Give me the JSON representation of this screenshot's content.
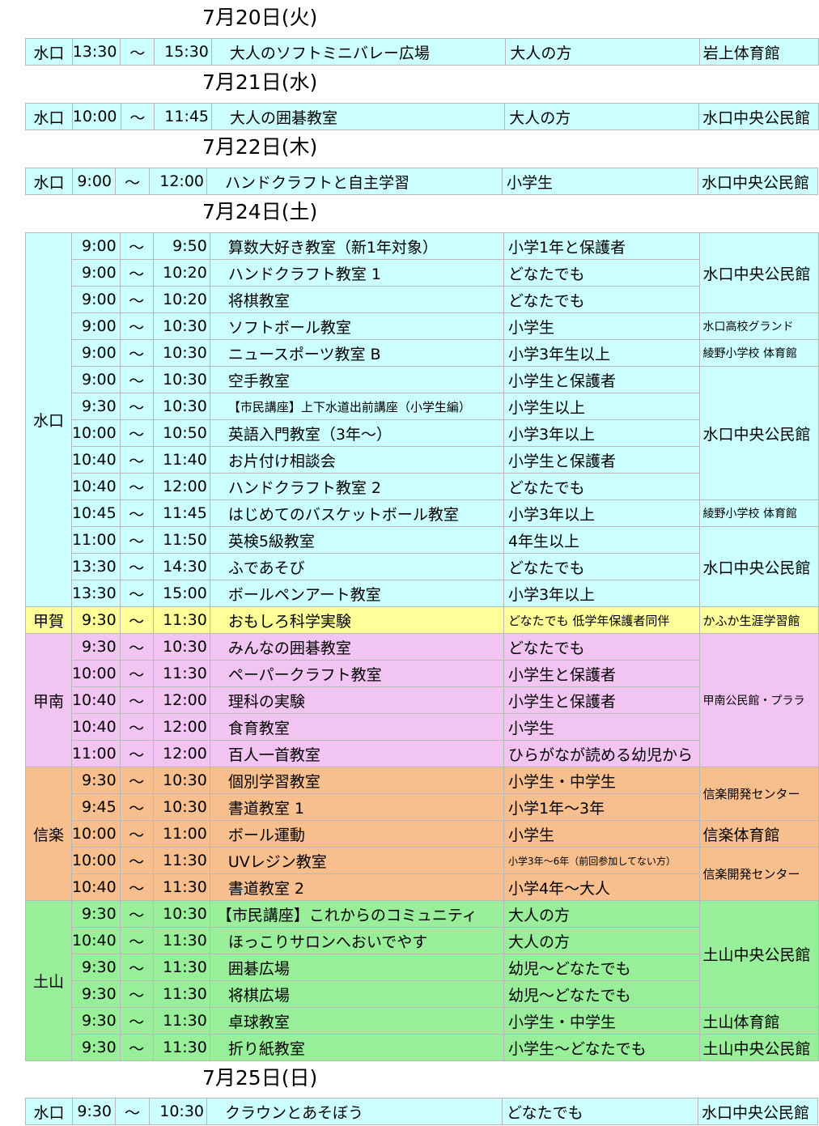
{
  "days": [
    {
      "date": "7月20日(火)",
      "rows": [
        {
          "area": "水口",
          "start": "13:30",
          "tilde": "～",
          "end": "15:30",
          "name": "大人のソフトミニバレー広場",
          "target": "大人の方",
          "venue": "岩上体育館"
        }
      ]
    },
    {
      "date": "7月21日(水)",
      "rows": [
        {
          "area": "水口",
          "start": "10:00",
          "tilde": "～",
          "end": "11:45",
          "name": "大人の囲碁教室",
          "target": "大人の方",
          "venue": "水口中央公民館"
        }
      ]
    },
    {
      "date": "7月22日(木)",
      "rows": [
        {
          "area": "水口",
          "start": "9:00",
          "tilde": "～",
          "end": "12:00",
          "name": "ハンドクラフトと自主学習",
          "target": "小学生",
          "venue": "水口中央公民館"
        }
      ]
    },
    {
      "date": "7月24日(土)",
      "rows": [
        {
          "area": "水口",
          "start": "9:00",
          "tilde": "～",
          "end": "9:50",
          "name": "算数大好き教室（新1年対象）",
          "target": "小学1年と保護者",
          "venue": "水口中央公民館"
        },
        {
          "start": "9:00",
          "tilde": "～",
          "end": "10:20",
          "name": "ハンドクラフト教室 1",
          "target": "どなたでも"
        },
        {
          "start": "9:00",
          "tilde": "～",
          "end": "10:20",
          "name": "将棋教室",
          "target": "どなたでも"
        },
        {
          "start": "9:00",
          "tilde": "～",
          "end": "10:30",
          "name": "ソフトボール教室",
          "target": "小学生",
          "venue": "水口高校グランド"
        },
        {
          "start": "9:00",
          "tilde": "～",
          "end": "10:30",
          "name": "ニュースポーツ教室 B",
          "target": "小学3年生以上",
          "venue": "綾野小学校 体育館"
        },
        {
          "start": "9:00",
          "tilde": "～",
          "end": "10:30",
          "name": "空手教室",
          "target": "小学生と保護者",
          "venue": "水口中央公民館"
        },
        {
          "start": "9:30",
          "tilde": "～",
          "end": "10:30",
          "name": "【市民講座】上下水道出前講座（小学生編）",
          "target": "小学生以上"
        },
        {
          "start": "10:00",
          "tilde": "～",
          "end": "10:50",
          "name": "英語入門教室（3年～）",
          "target": "小学3年以上"
        },
        {
          "start": "10:40",
          "tilde": "～",
          "end": "11:40",
          "name": "お片付け相談会",
          "target": "小学生と保護者"
        },
        {
          "start": "10:40",
          "tilde": "～",
          "end": "12:00",
          "name": "ハンドクラフト教室 2",
          "target": "どなたでも"
        },
        {
          "start": "10:45",
          "tilde": "～",
          "end": "11:45",
          "name": "はじめてのバスケットボール教室",
          "target": "小学3年以上",
          "venue": "綾野小学校 体育館"
        },
        {
          "start": "11:00",
          "tilde": "～",
          "end": "11:50",
          "name": "英検5級教室",
          "target": "4年生以上",
          "venue": "水口中央公民館"
        },
        {
          "start": "13:30",
          "tilde": "～",
          "end": "14:30",
          "name": "ふであそび",
          "target": "どなたでも"
        },
        {
          "start": "13:30",
          "tilde": "～",
          "end": "15:00",
          "name": "ボールペンアート教室",
          "target": "小学3年以上"
        },
        {
          "area": "甲賀",
          "start": "9:30",
          "tilde": "～",
          "end": "11:30",
          "name": "おもしろ科学実験",
          "target": "どなたでも 低学年保護者同伴",
          "venue": "かふか生涯学習館"
        },
        {
          "area": "甲南",
          "start": "9:30",
          "tilde": "～",
          "end": "10:30",
          "name": "みんなの囲碁教室",
          "target": "どなたでも",
          "venue": "甲南公民館・プララ"
        },
        {
          "start": "10:00",
          "tilde": "～",
          "end": "11:30",
          "name": "ペーパークラフト教室",
          "target": "小学生と保護者"
        },
        {
          "start": "10:40",
          "tilde": "～",
          "end": "12:00",
          "name": "理科の実験",
          "target": "小学生と保護者"
        },
        {
          "start": "10:40",
          "tilde": "～",
          "end": "12:00",
          "name": "食育教室",
          "target": "小学生"
        },
        {
          "start": "11:00",
          "tilde": "～",
          "end": "12:00",
          "name": "百人一首教室",
          "target": "ひらがなが読める幼児から"
        },
        {
          "area": "信楽",
          "start": "9:30",
          "tilde": "～",
          "end": "10:30",
          "name": "個別学習教室",
          "target": "小学生・中学生",
          "venue": "信楽開発センター"
        },
        {
          "start": "9:45",
          "tilde": "～",
          "end": "10:30",
          "name": "書道教室 1",
          "target": "小学1年～3年"
        },
        {
          "start": "10:00",
          "tilde": "～",
          "end": "11:00",
          "name": "ボール運動",
          "target": "小学生",
          "venue": "信楽体育館"
        },
        {
          "start": "10:00",
          "tilde": "～",
          "end": "11:30",
          "name": "UVレジン教室",
          "target": "小学3年～6年（前回参加してない方）",
          "venue": "信楽開発センター"
        },
        {
          "start": "10:40",
          "tilde": "～",
          "end": "11:30",
          "name": "書道教室 2",
          "target": "小学4年～大人"
        },
        {
          "area": "土山",
          "start": "9:30",
          "tilde": "～",
          "end": "10:30",
          "name": "【市民講座】これからのコミュニティ",
          "target": "大人の方",
          "venue": "土山中央公民館"
        },
        {
          "start": "10:40",
          "tilde": "～",
          "end": "11:30",
          "name": "ほっこりサロンへおいでやす",
          "target": "大人の方"
        },
        {
          "start": "9:30",
          "tilde": "～",
          "end": "11:30",
          "name": "囲碁広場",
          "target": "幼児～どなたでも"
        },
        {
          "start": "9:30",
          "tilde": "～",
          "end": "11:30",
          "name": "将棋広場",
          "target": "幼児～どなたでも"
        },
        {
          "start": "9:30",
          "tilde": "～",
          "end": "11:30",
          "name": "卓球教室",
          "target": "小学生・中学生",
          "venue": "土山体育館"
        },
        {
          "start": "9:30",
          "tilde": "～",
          "end": "11:30",
          "name": "折り紙教室",
          "target": "小学生～どなたでも",
          "venue": "土山中央公民館"
        }
      ]
    },
    {
      "date": "7月25日(日)",
      "rows": [
        {
          "area": "水口",
          "start": "9:30",
          "tilde": "～",
          "end": "10:30",
          "name": "クラウンとあそぼう",
          "target": "どなたでも",
          "venue": "水口中央公民館"
        }
      ]
    }
  ],
  "colors": {
    "minakuchi": "#ccffff",
    "koka": "#ffff99",
    "konan": "#f2c4f2",
    "shigaraki": "#f8bf8e",
    "tsuchiyama": "#99ee99",
    "grid": "#b8b8b8"
  }
}
